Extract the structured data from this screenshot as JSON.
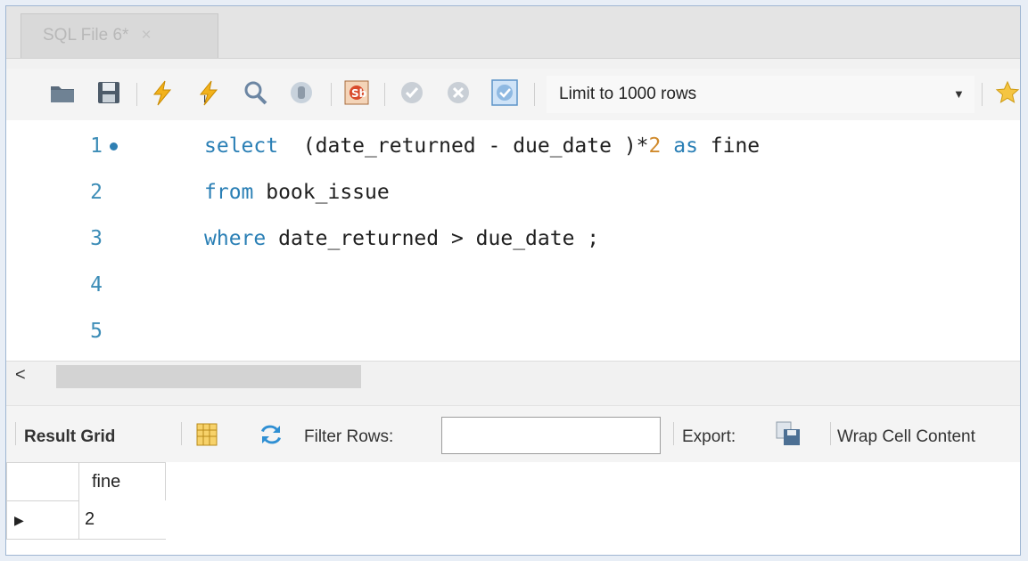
{
  "tab": {
    "title": "SQL File 6*",
    "close": "×"
  },
  "toolbar": {
    "limit_label": "Limit to 1000 rows"
  },
  "editor": {
    "lines": [
      {
        "num": "1"
      },
      {
        "num": "2"
      },
      {
        "num": "3"
      },
      {
        "num": "4"
      },
      {
        "num": "5"
      }
    ],
    "tokens": {
      "l1_select": "select",
      "l1_rest": "  (date_returned - due_date )*",
      "l1_num": "2",
      "l1_as": " as",
      "l1_fine": " fine",
      "l2_from": "from",
      "l2_rest": " book_issue",
      "l3_where": "where",
      "l3_rest": " date_returned > due_date ;"
    }
  },
  "scrollbar": {
    "left_arrow": "<"
  },
  "results": {
    "result_grid_label": "Result Grid",
    "filter_rows_label": "Filter Rows:",
    "filter_value": "",
    "export_label": "Export:",
    "wrap_label": "Wrap Cell Content",
    "column_header": "fine",
    "rows": [
      {
        "fine": "2"
      }
    ]
  },
  "colors": {
    "keyword": "#2a7fb5",
    "number": "#d08a2c",
    "line_number": "#3d8db7"
  }
}
